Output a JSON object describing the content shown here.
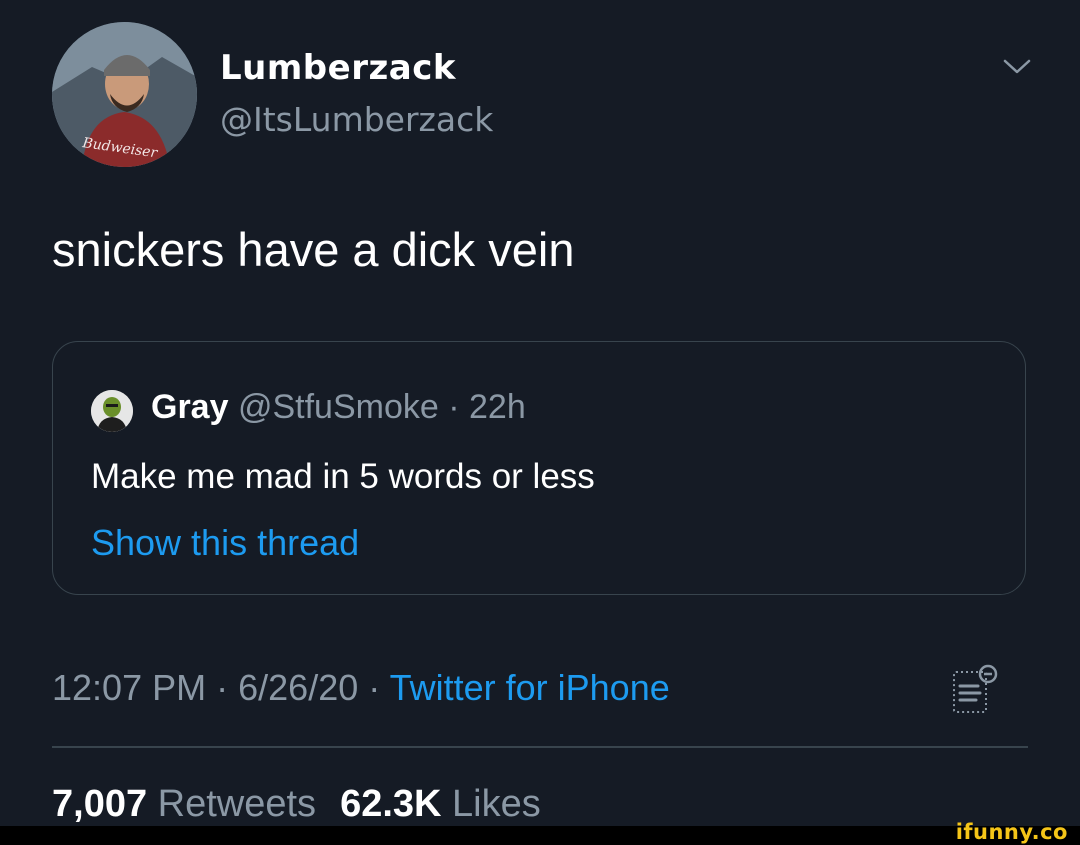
{
  "author": {
    "display_name": "Lumberzack",
    "handle": "@ItsLumberzack",
    "avatar_icon": "profile-photo"
  },
  "tweet": {
    "text": "snickers have a dick vein"
  },
  "quoted_tweet": {
    "name": "Gray",
    "handle": "@StfuSmoke",
    "separator": "·",
    "time": "22h",
    "text": "Make me mad in 5 words or less",
    "thread_link": "Show this thread"
  },
  "meta": {
    "time": "12:07 PM",
    "separator": "·",
    "date": "6/26/20",
    "source": "Twitter for iPhone"
  },
  "stats": {
    "retweets_count": "7,007",
    "retweets_label": "Retweets",
    "likes_count": "62.3K",
    "likes_label": "Likes"
  },
  "watermark": "ifunny.co",
  "colors": {
    "background": "#151b25",
    "link": "#1d9bf0",
    "secondary_text": "#8b98a5",
    "border": "#38444d",
    "watermark": "#f5c518"
  }
}
